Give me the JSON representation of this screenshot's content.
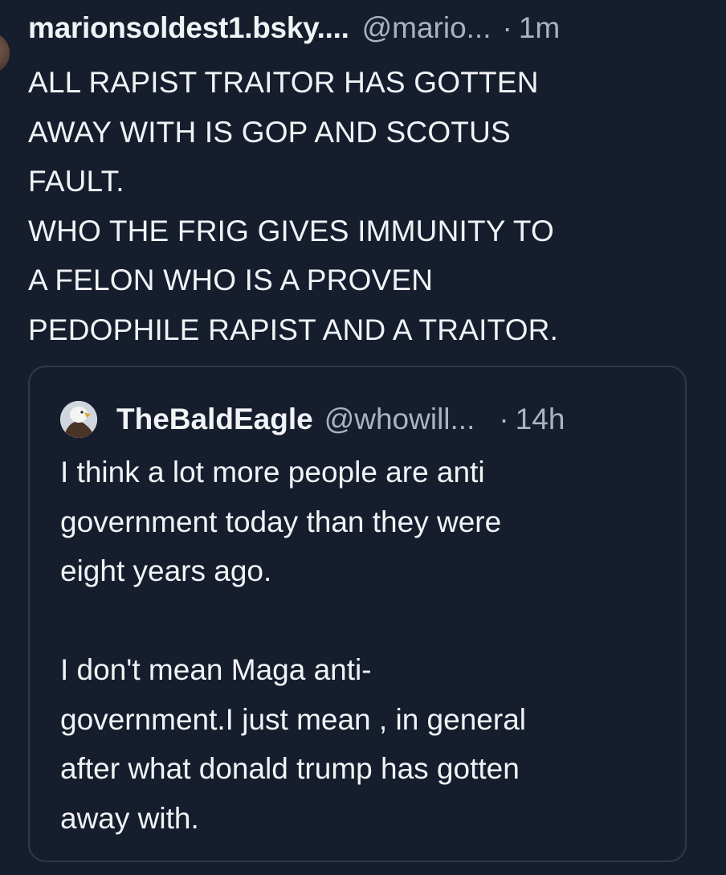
{
  "post": {
    "author": "marionsoldest1.bsky....",
    "handle": "@mario...",
    "separator": "·",
    "time": "1m",
    "text": "ALL RAPIST TRAITOR HAS GOTTEN\nAWAY WITH IS GOP AND SCOTUS\nFAULT.\nWHO THE FRIG GIVES IMMUNITY TO\nA FELON WHO IS A PROVEN\nPEDOPHILE RAPIST AND A TRAITOR."
  },
  "quote": {
    "author": "TheBaldEagle",
    "handle": "@whowill...",
    "separator": "·",
    "time": "14h",
    "avatar_icon": "bald-eagle-avatar",
    "text": "I think a lot more people are anti\ngovernment today than they were\neight years ago.\n\nI don't mean Maga anti-\ngovernment.I just mean , in general\nafter what donald trump has gotten\naway with."
  },
  "colors": {
    "background": "#161e2e",
    "text": "#f1f3f5",
    "muted": "#aab3c0",
    "card_border": "#2d3a4f"
  }
}
